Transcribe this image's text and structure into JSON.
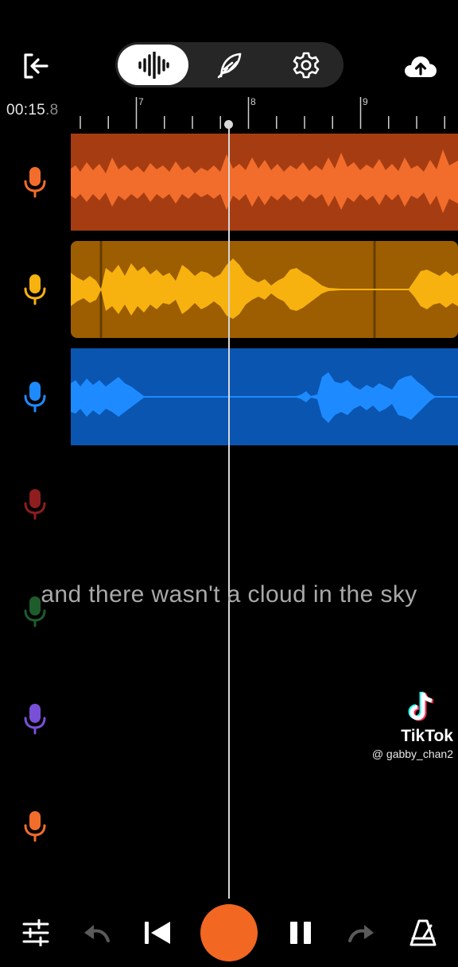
{
  "header": {
    "exit_icon": "exit-icon",
    "tabs": [
      {
        "icon": "waveform-icon",
        "active": true
      },
      {
        "icon": "feather-icon",
        "active": false
      },
      {
        "icon": "gear-icon",
        "active": false
      }
    ],
    "upload_icon": "cloud-upload-icon"
  },
  "timeline": {
    "time_main": "00:15",
    "time_fraction": ".8",
    "ruler_labels": [
      "7",
      "8",
      "9"
    ]
  },
  "tracks": [
    {
      "color": "#f26d2b",
      "bg": "#a63d12",
      "mic_color": "#f26d2b"
    },
    {
      "color": "#f7b20f",
      "bg": "#9c5e00",
      "mic_color": "#f7b20f"
    },
    {
      "color": "#1d8bff",
      "bg": "#0a55b0",
      "mic_color": "#1d8bff"
    },
    {
      "color": "#8e1d1d",
      "mic_color": "#8e1d1d"
    },
    {
      "color": "#1f5c2b",
      "mic_color": "#1f5c2b"
    },
    {
      "color": "#7a4fd8",
      "mic_color": "#7a4fd8"
    },
    {
      "color": "#f26d2b",
      "mic_color": "#f26d2b"
    }
  ],
  "caption": "and there wasn't a cloud in the sky",
  "watermark": {
    "brand": "TikTok",
    "handle": "@ gabby_chan2"
  },
  "bottom_bar": {
    "icons": [
      "mixer-sliders-icon",
      "undo-icon",
      "skip-back-icon",
      "record-button",
      "pause-icon",
      "redo-icon",
      "metronome-icon"
    ],
    "record_color": "#f26722"
  }
}
